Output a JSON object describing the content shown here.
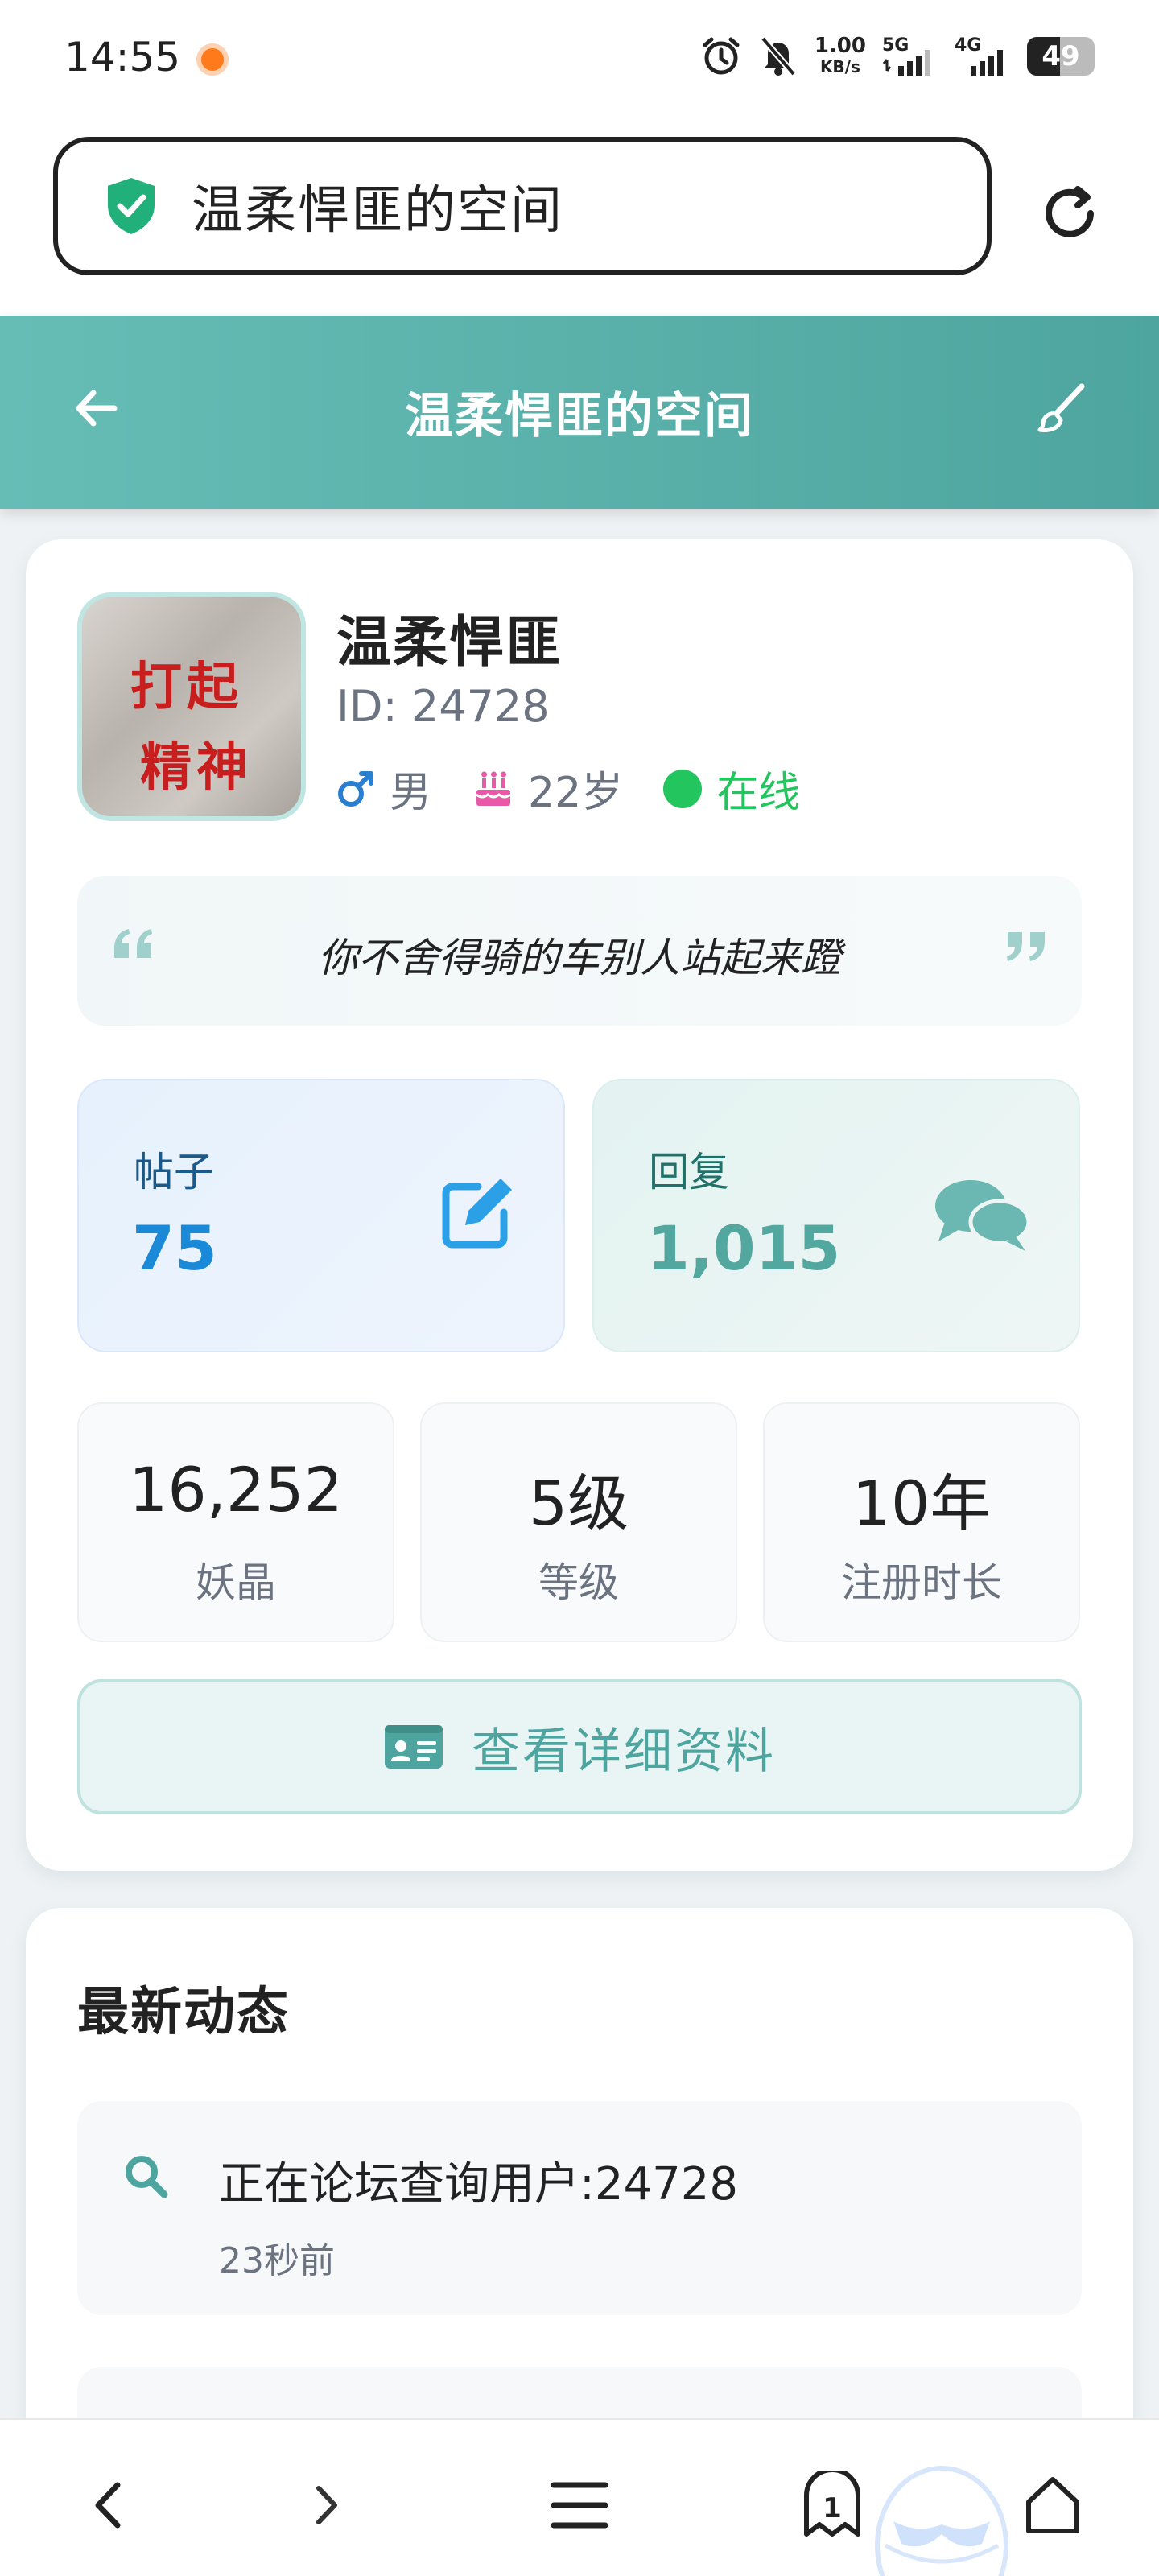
{
  "status_bar": {
    "time": "14:55",
    "net_speed_value": "1.00",
    "net_speed_unit": "KB/s",
    "signal_1_label": "5G",
    "signal_2_label": "4G",
    "battery_level": "49",
    "battery_fraction": 0.49
  },
  "browser": {
    "url_title": "温柔悍匪的空间",
    "reload_icon": "reload-icon"
  },
  "header": {
    "title": "温柔悍匪的空间"
  },
  "profile": {
    "avatar_line1": "打起",
    "avatar_line2": "精神",
    "name": "温柔悍匪",
    "id_text": "ID: 24728",
    "gender": "男",
    "age": "22岁",
    "status": "在线",
    "signature": "你不舍得骑的车别人站起来蹬"
  },
  "stats_main": [
    {
      "label": "帖子",
      "value": "75"
    },
    {
      "label": "回复",
      "value": "1,015"
    }
  ],
  "stats_small": [
    {
      "value": "16,252",
      "label": "妖晶"
    },
    {
      "value": "5级",
      "label": "等级"
    },
    {
      "value": "10年",
      "label": "注册时长"
    }
  ],
  "detail_button": {
    "label": "查看详细资料"
  },
  "activity": {
    "title": "最新动态",
    "items": [
      {
        "text": "正在论坛查询用户:24728",
        "time": "23秒前"
      }
    ]
  },
  "bottom_nav": {
    "tab_count": "1"
  },
  "colors": {
    "accent": "#4ea59f",
    "posts_blue": "#1a8ad8",
    "online_green": "#22c55e"
  }
}
